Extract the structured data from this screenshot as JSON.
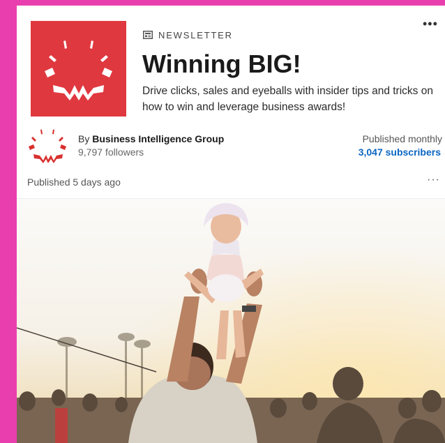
{
  "newsletter": {
    "label": "NEWSLETTER",
    "label_icon": "newspaper-icon",
    "title": "Winning BIG!",
    "description": "Drive clicks, sales and eyeballs with insider tips and tricks on how to win and leverage business awards!",
    "more_icon": "more-options-icon",
    "more_glyph": "•••"
  },
  "author": {
    "by_prefix": "By ",
    "name": "Business Intelligence Group",
    "followers": "9,797 followers",
    "logo_icon": "business-intelligence-group-logo"
  },
  "publication": {
    "frequency": "Published monthly",
    "subscribers": "3,047 subscribers"
  },
  "post": {
    "published": "Published 5 days ago",
    "more_glyph": "···"
  },
  "colors": {
    "brand_red": "#e0383f",
    "link_blue": "#0a66c2",
    "page_bg": "#e93fae"
  }
}
